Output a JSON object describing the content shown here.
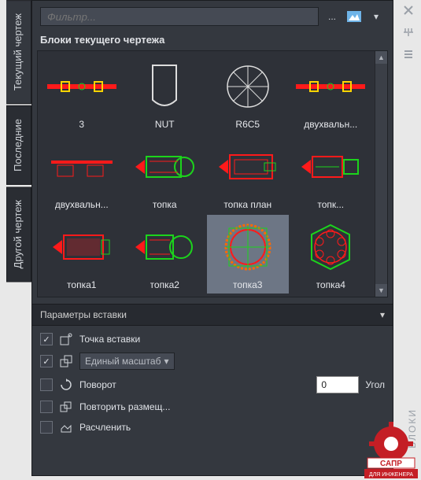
{
  "panel_title": "БЛОКИ",
  "filter": {
    "placeholder": "Фильтр...",
    "more": "..."
  },
  "tabs": {
    "current": "Текущий чертеж",
    "recent": "Последние",
    "other": "Другой чертеж"
  },
  "section_title": "Блоки текущего чертежа",
  "blocks": [
    {
      "label": "3"
    },
    {
      "label": "NUT"
    },
    {
      "label": "R6C5"
    },
    {
      "label": "двухвальн..."
    },
    {
      "label": "двухвальн..."
    },
    {
      "label": "топка"
    },
    {
      "label": "топка план"
    },
    {
      "label": "топк..."
    },
    {
      "label": "топка1"
    },
    {
      "label": "топка2"
    },
    {
      "label": "топка3",
      "selected": true
    },
    {
      "label": "топка4"
    }
  ],
  "params": {
    "header": "Параметры вставки",
    "insertion_point": {
      "label": "Точка вставки",
      "checked": true
    },
    "scale": {
      "label": "Единый масштаб",
      "checked": true
    },
    "rotation": {
      "label": "Поворот",
      "checked": false,
      "value": "0",
      "unit": "Угол"
    },
    "repeat": {
      "label": "Повторить размещ...",
      "checked": false
    },
    "explode": {
      "label": "Расчленить",
      "checked": false
    }
  },
  "logo": {
    "top": "САПР",
    "bottom": "ДЛЯ ИНЖЕНЕРА"
  }
}
